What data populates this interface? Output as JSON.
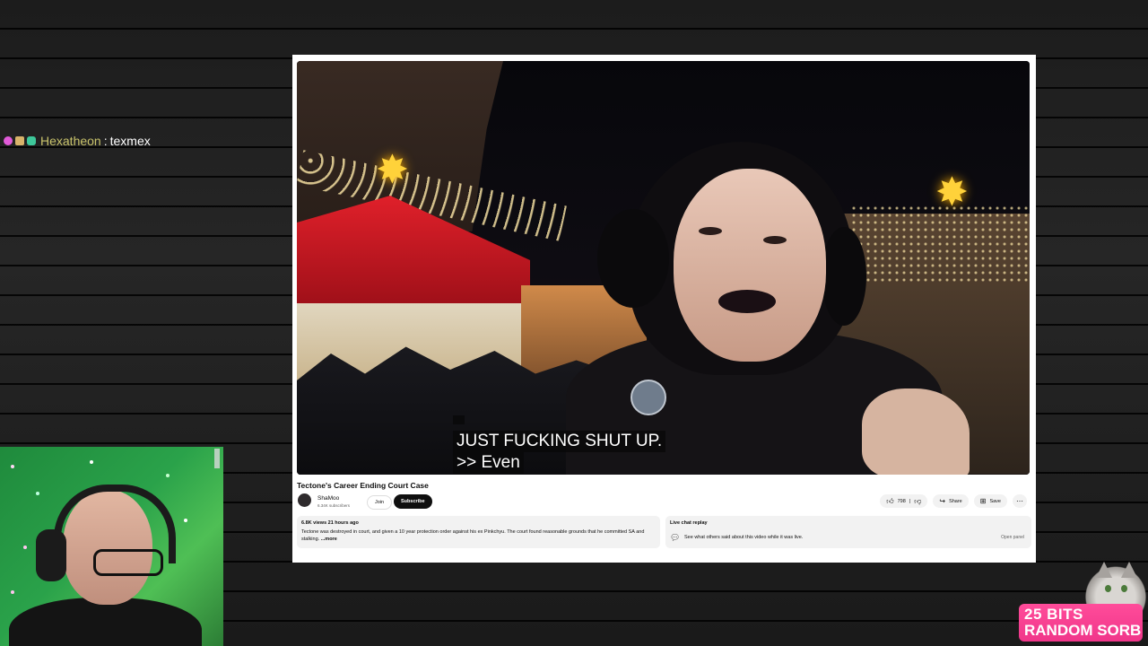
{
  "chat": {
    "username": "Hexatheon",
    "separator": ":",
    "message": "texmex"
  },
  "video": {
    "captions": [
      "JUST FUCKING SHUT UP.",
      ">> Even"
    ],
    "title": "Tectone's Career Ending Court Case",
    "channel": {
      "name": "ShaMoo",
      "subscribers": "6.34K subscribers"
    },
    "join_label": "Join",
    "subscribe_label": "Subscribe",
    "like_count": "798",
    "share_label": "Share",
    "save_label": "Save",
    "more_icon": "⋯"
  },
  "description": {
    "meta": "6.8K views  21 hours ago",
    "text": "Tectone was destroyed in court, and given a 10 year protection order against his ex Pinkchyu. The court found reasonable grounds that he committed SA and stalking.",
    "more": " ...more"
  },
  "live_chat": {
    "title": "Live chat replay",
    "text": "See what others said about this video while it was live.",
    "open_label": "Open panel"
  },
  "alert": {
    "line1": "25 BITS",
    "line2": "RANDOM SORB",
    "color": "#f0368a"
  },
  "colors": {
    "subscribe_bg": "#0f0f0f",
    "chat_username": "#c9c36b"
  }
}
